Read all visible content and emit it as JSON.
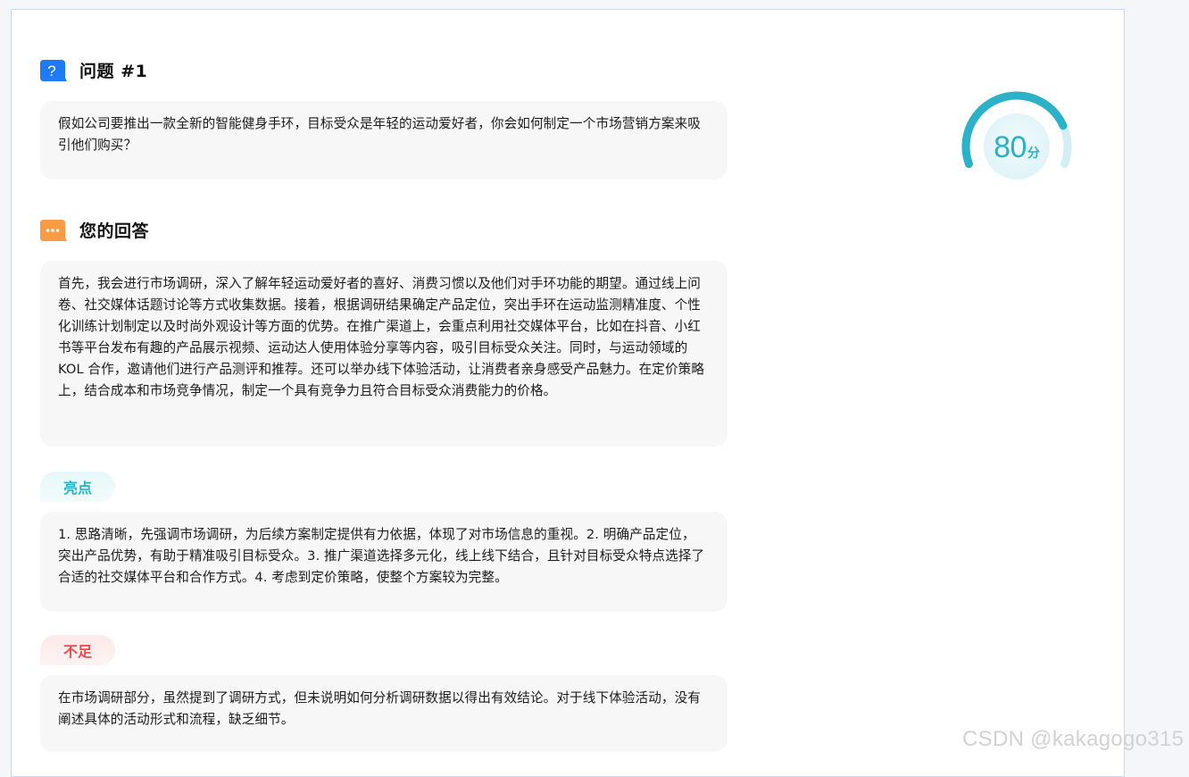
{
  "question": {
    "title": "问题 #1",
    "text": "假如公司要推出一款全新的智能健身手环，目标受众是年轻的运动爱好者，你会如何制定一个市场营销方案来吸引他们购买？"
  },
  "answer": {
    "title": "您的回答",
    "text": "首先，我会进行市场调研，深入了解年轻运动爱好者的喜好、消费习惯以及他们对手环功能的期望。通过线上问卷、社交媒体话题讨论等方式收集数据。接着，根据调研结果确定产品定位，突出手环在运动监测精准度、个性化训练计划制定以及时尚外观设计等方面的优势。在推广渠道上，会重点利用社交媒体平台，比如在抖音、小红书等平台发布有趣的产品展示视频、运动达人使用体验分享等内容，吸引目标受众关注。同时，与运动领域的 KOL 合作，邀请他们进行产品测评和推荐。还可以举办线下体验活动，让消费者亲身感受产品魅力。在定价策略上，结合成本和市场竞争情况，制定一个具有竞争力且符合目标受众消费能力的价格。"
  },
  "highlights": {
    "label": "亮点",
    "text": "1. 思路清晰，先强调市场调研，为后续方案制定提供有力依据，体现了对市场信息的重视。2. 明确产品定位，突出产品优势，有助于精准吸引目标受众。3. 推广渠道选择多元化，线上线下结合，且针对目标受众特点选择了合适的社交媒体平台和合作方式。4. 考虑到定价策略，使整个方案较为完整。"
  },
  "shortcomings": {
    "label": "不足",
    "text": "在市场调研部分，虽然提到了调研方式，但未说明如何分析调研数据以得出有效结论。对于线下体验活动，没有阐述具体的活动形式和流程，缺乏细节。"
  },
  "score": {
    "value": "80",
    "unit": "分",
    "fraction": 0.8
  },
  "colors": {
    "accent": "#2bb1c8",
    "question_icon": "#1e7bf5",
    "answer_icon": "#f79b45",
    "negative": "#ef4b4f"
  },
  "icons": {
    "question": "question-bubble-icon",
    "answer": "chat-bubble-icon"
  },
  "watermark": "CSDN @kakagogo315"
}
